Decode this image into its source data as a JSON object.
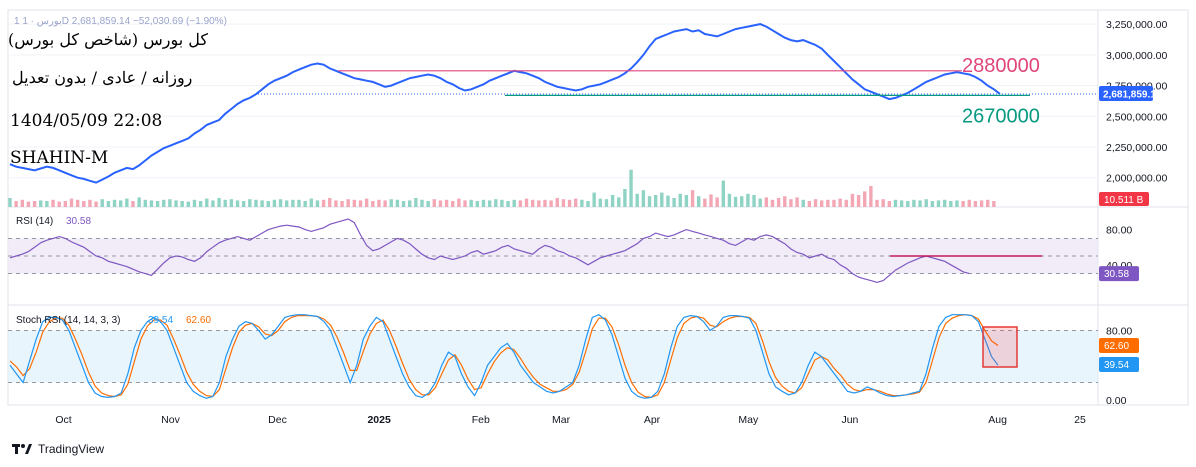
{
  "header": {
    "symbol_line": "1 بورس · 1D  2,681,859.14  −52,030.69 (−1.90%)",
    "title": "(کل بورس (شاخص کل بورس",
    "subtitle": "روزانه / عادی / بدون تعدیل",
    "datetime": "1404/05/09 22:08",
    "author": "SHAHIN-M"
  },
  "branding": {
    "name": "TradingView",
    "logo_icon": "tradingview-logo-icon"
  },
  "chart_data": [
    {
      "type": "line",
      "title": "",
      "yaxis_labels": [
        "3,250,000.00",
        "3,000,000.00",
        "2,750,000.00",
        "2,500,000.00",
        "2,250,000.00",
        "2,000,000.00"
      ],
      "ylim": [
        1900000,
        3300000
      ],
      "last_value": "2,681,859.14",
      "volume_badge": "10.511 B",
      "levels": [
        {
          "label": "2880000",
          "value": 2870000,
          "color": "#e0457b"
        },
        {
          "label": "2670000",
          "value": 2670000,
          "color": "#089981"
        }
      ],
      "line_color": "#2962ff",
      "series": [
        {
          "values": [
            2110000,
            2090000,
            2080000,
            2070000,
            2060000,
            2075000,
            2090000,
            2080000,
            2060000,
            2040000,
            2020000,
            2000000,
            1990000,
            1975000,
            1960000,
            1985000,
            2010000,
            2040000,
            2060000,
            2080000,
            2070000,
            2100000,
            2140000,
            2180000,
            2210000,
            2240000,
            2260000,
            2280000,
            2300000,
            2320000,
            2360000,
            2390000,
            2430000,
            2450000,
            2470000,
            2520000,
            2560000,
            2600000,
            2630000,
            2650000,
            2680000,
            2720000,
            2760000,
            2790000,
            2810000,
            2830000,
            2860000,
            2880000,
            2900000,
            2920000,
            2930000,
            2920000,
            2890000,
            2870000,
            2850000,
            2830000,
            2810000,
            2800000,
            2790000,
            2780000,
            2760000,
            2740000,
            2750000,
            2770000,
            2790000,
            2810000,
            2820000,
            2830000,
            2840000,
            2830000,
            2810000,
            2780000,
            2760000,
            2730000,
            2710000,
            2720000,
            2740000,
            2760000,
            2790000,
            2810000,
            2830000,
            2850000,
            2870000,
            2860000,
            2850000,
            2830000,
            2810000,
            2780000,
            2760000,
            2740000,
            2730000,
            2720000,
            2710000,
            2720000,
            2740000,
            2750000,
            2760000,
            2780000,
            2800000,
            2820000,
            2850000,
            2890000,
            2940000,
            3000000,
            3070000,
            3130000,
            3150000,
            3170000,
            3190000,
            3200000,
            3210000,
            3190000,
            3200000,
            3170000,
            3160000,
            3150000,
            3170000,
            3190000,
            3210000,
            3220000,
            3230000,
            3240000,
            3250000,
            3230000,
            3200000,
            3170000,
            3140000,
            3120000,
            3110000,
            3120000,
            3100000,
            3080000,
            3050000,
            3000000,
            2950000,
            2900000,
            2850000,
            2800000,
            2760000,
            2720000,
            2700000,
            2680000,
            2660000,
            2640000,
            2650000,
            2670000,
            2690000,
            2720000,
            2750000,
            2780000,
            2800000,
            2820000,
            2840000,
            2850000,
            2860000,
            2850000,
            2840000,
            2820000,
            2790000,
            2750000,
            2720000,
            2682000
          ]
        }
      ],
      "volume_values": [
        0.15,
        0.1,
        0.12,
        0.09,
        0.1,
        0.11,
        0.1,
        0.12,
        0.09,
        0.1,
        0.14,
        0.12,
        0.1,
        0.12,
        0.09,
        0.13,
        0.1,
        0.12,
        0.11,
        0.14,
        0.1,
        0.16,
        0.12,
        0.11,
        0.1,
        0.12,
        0.13,
        0.11,
        0.1,
        0.09,
        0.12,
        0.1,
        0.14,
        0.11,
        0.15,
        0.12,
        0.13,
        0.11,
        0.1,
        0.13,
        0.12,
        0.11,
        0.1,
        0.12,
        0.13,
        0.11,
        0.12,
        0.12,
        0.1,
        0.14,
        0.11,
        0.12,
        0.15,
        0.11,
        0.1,
        0.13,
        0.12,
        0.11,
        0.14,
        0.1,
        0.12,
        0.11,
        0.13,
        0.12,
        0.1,
        0.11,
        0.15,
        0.12,
        0.1,
        0.13,
        0.11,
        0.12,
        0.1,
        0.14,
        0.11,
        0.12,
        0.1,
        0.12,
        0.11,
        0.13,
        0.12,
        0.1,
        0.12,
        0.11,
        0.14,
        0.12,
        0.11,
        0.12,
        0.11,
        0.15,
        0.13,
        0.12,
        0.14,
        0.12,
        0.1,
        0.24,
        0.14,
        0.13,
        0.2,
        0.16,
        0.3,
        0.62,
        0.22,
        0.28,
        0.18,
        0.2,
        0.24,
        0.19,
        0.15,
        0.22,
        0.2,
        0.28,
        0.18,
        0.14,
        0.21,
        0.16,
        0.44,
        0.22,
        0.17,
        0.18,
        0.22,
        0.2,
        0.14,
        0.16,
        0.12,
        0.15,
        0.18,
        0.13,
        0.16,
        0.12,
        0.1,
        0.13,
        0.11,
        0.12,
        0.12,
        0.14,
        0.12,
        0.22,
        0.2,
        0.26,
        0.35,
        0.12,
        0.13,
        0.1,
        0.12,
        0.11,
        0.1,
        0.12,
        0.11,
        0.13,
        0.1,
        0.11,
        0.12,
        0.1,
        0.11,
        0.1,
        0.12,
        0.1,
        0.11,
        0.12,
        0.1
      ]
    },
    {
      "type": "line",
      "title": "RSI (14)",
      "value_label": "30.58",
      "ylim": [
        0,
        100
      ],
      "yaxis_labels": [
        "80.00",
        "40.00"
      ],
      "band": [
        30,
        70
      ],
      "midline": 50,
      "line_color": "#7e57c2",
      "resistance_color": "#c2185b",
      "resistance_value": 50,
      "series": [
        {
          "values": [
            48,
            50,
            52,
            55,
            60,
            65,
            68,
            70,
            72,
            70,
            66,
            63,
            60,
            55,
            50,
            48,
            44,
            42,
            40,
            38,
            35,
            32,
            30,
            28,
            35,
            42,
            48,
            50,
            49,
            46,
            44,
            48,
            55,
            60,
            65,
            68,
            70,
            72,
            70,
            68,
            72,
            76,
            80,
            82,
            84,
            85,
            84,
            83,
            80,
            78,
            80,
            82,
            86,
            88,
            90,
            92,
            88,
            74,
            62,
            56,
            58,
            62,
            66,
            70,
            68,
            64,
            58,
            52,
            48,
            46,
            50,
            48,
            46,
            48,
            50,
            54,
            56,
            52,
            54,
            56,
            60,
            62,
            58,
            56,
            54,
            52,
            58,
            62,
            60,
            56,
            54,
            50,
            48,
            44,
            40,
            44,
            48,
            50,
            52,
            54,
            56,
            60,
            64,
            70,
            72,
            76,
            74,
            72,
            74,
            77,
            80,
            78,
            76,
            74,
            72,
            70,
            68,
            64,
            62,
            66,
            70,
            68,
            72,
            74,
            72,
            68,
            64,
            58,
            54,
            52,
            48,
            50,
            52,
            48,
            46,
            40,
            36,
            30,
            26,
            24,
            22,
            20,
            22,
            28,
            34,
            38,
            42,
            45,
            48,
            50,
            48,
            46,
            44,
            40,
            36,
            32,
            30
          ]
        }
      ]
    },
    {
      "type": "line",
      "title": "Stoch RSI (14, 14, 3, 3)",
      "k_label": "39.54",
      "d_label": "62.60",
      "k_color": "#2196f3",
      "d_color": "#ff6d00",
      "ylim": [
        0,
        100
      ],
      "yaxis_labels": [
        "80.00",
        "0.00"
      ],
      "band": [
        20,
        80
      ],
      "series": [
        {
          "values": [
            40,
            30,
            20,
            45,
            70,
            90,
            95,
            95,
            92,
            80,
            60,
            40,
            20,
            8,
            4,
            3,
            4,
            8,
            30,
            60,
            80,
            90,
            95,
            90,
            80,
            60,
            40,
            20,
            10,
            5,
            2,
            4,
            20,
            50,
            70,
            85,
            90,
            88,
            80,
            70,
            75,
            85,
            95,
            97,
            98,
            98,
            97,
            96,
            90,
            80,
            60,
            40,
            20,
            40,
            70,
            85,
            95,
            90,
            70,
            50,
            30,
            15,
            5,
            3,
            8,
            20,
            40,
            55,
            50,
            30,
            15,
            5,
            20,
            40,
            50,
            60,
            65,
            55,
            40,
            30,
            20,
            15,
            10,
            8,
            10,
            15,
            20,
            40,
            70,
            95,
            98,
            92,
            75,
            50,
            25,
            10,
            4,
            2,
            3,
            10,
            30,
            60,
            85,
            95,
            97,
            96,
            90,
            80,
            85,
            95,
            97,
            97,
            96,
            94,
            80,
            55,
            30,
            15,
            10,
            6,
            8,
            20,
            40,
            55,
            50,
            40,
            30,
            20,
            10,
            8,
            10,
            15,
            12,
            8,
            5,
            4,
            5,
            6,
            8,
            10,
            30,
            60,
            85,
            95,
            98,
            98,
            98,
            97,
            90,
            70,
            50,
            40
          ]
        },
        {
          "values": [
            45,
            38,
            28,
            36,
            55,
            78,
            90,
            94,
            94,
            86,
            70,
            52,
            32,
            16,
            8,
            5,
            4,
            6,
            18,
            44,
            70,
            85,
            92,
            92,
            86,
            70,
            52,
            32,
            18,
            10,
            5,
            4,
            12,
            36,
            60,
            78,
            86,
            88,
            84,
            76,
            74,
            80,
            90,
            95,
            97,
            97,
            97,
            96,
            93,
            86,
            72,
            54,
            34,
            34,
            56,
            76,
            88,
            92,
            80,
            62,
            42,
            24,
            12,
            6,
            6,
            14,
            30,
            46,
            52,
            40,
            24,
            12,
            14,
            30,
            44,
            54,
            60,
            58,
            48,
            36,
            26,
            18,
            14,
            10,
            10,
            12,
            18,
            32,
            56,
            82,
            94,
            94,
            84,
            64,
            40,
            20,
            9,
            4,
            3,
            6,
            20,
            46,
            72,
            88,
            94,
            96,
            94,
            86,
            84,
            90,
            94,
            96,
            96,
            95,
            88,
            68,
            44,
            26,
            16,
            10,
            8,
            14,
            30,
            46,
            50,
            46,
            36,
            28,
            18,
            12,
            10,
            12,
            12,
            10,
            7,
            5,
            5,
            6,
            7,
            9,
            20,
            46,
            72,
            88,
            94,
            97,
            98,
            97,
            93,
            80,
            68,
            62.6
          ]
        }
      ]
    }
  ],
  "x_axis_labels": [
    {
      "label": "Oct",
      "pos": 0.05
    },
    {
      "label": "Nov",
      "pos": 0.15
    },
    {
      "label": "Dec",
      "pos": 0.25
    },
    {
      "label": "2025",
      "pos": 0.345,
      "bold": true
    },
    {
      "label": "Feb",
      "pos": 0.44
    },
    {
      "label": "Mar",
      "pos": 0.515
    },
    {
      "label": "Apr",
      "pos": 0.6
    },
    {
      "label": "May",
      "pos": 0.69
    },
    {
      "label": "Jun",
      "pos": 0.785
    },
    {
      "label": "Aug",
      "pos": 0.923
    },
    {
      "label": "25",
      "pos": 1.0
    }
  ]
}
